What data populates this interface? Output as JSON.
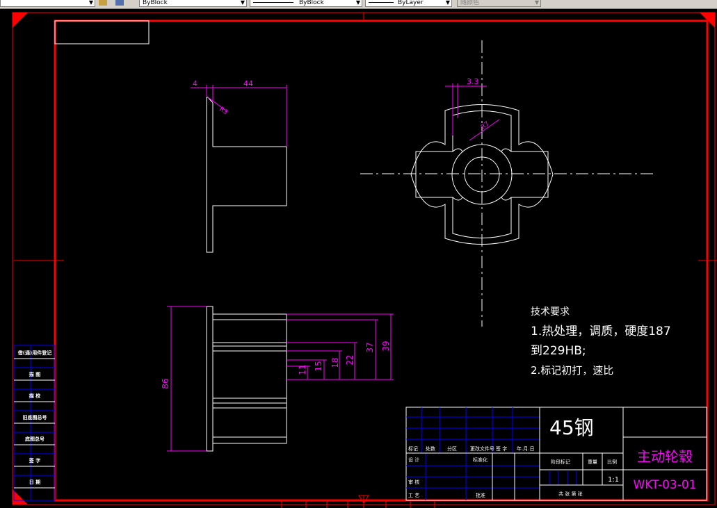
{
  "toolbar": {
    "linetype_value": "ByBlock",
    "lineweight_value": "ByBlock",
    "layer_lineweight_value": "ByLayer",
    "plotstyle_value": "随颜色"
  },
  "dims": {
    "d_4": "4",
    "d_44": "44",
    "r_r3": "R3",
    "d_3_3": "3.3",
    "r_r7": "R7",
    "d_86": "86",
    "d_11": "11",
    "d_15": "15",
    "d_18": "18",
    "d_22": "22",
    "d_37": "37",
    "d_39": "39"
  },
  "notes": {
    "heading": "技术要求",
    "line1": "1.热处理，调质，硬度187",
    "line2": "到229HB;",
    "line3": "2.标记初打，速比"
  },
  "side_labels": [
    "借(通)用件登记",
    "描  图",
    "描  校",
    "旧底图总号",
    "底图总号",
    "签  字",
    "日  期"
  ],
  "title_block": {
    "material": "45钢",
    "part_name": "主动轮毂",
    "drawing_number": "WKT-03-01",
    "scale": "1:1",
    "hdr_mark": "标记",
    "hdr_count": "处数",
    "hdr_zone": "分区",
    "hdr_change": "更改文件号",
    "hdr_sign": "签 字",
    "hdr_date": "年.月.日",
    "design": "设 计",
    "standardize": "标准化",
    "stage_mark": "阶段标记",
    "weight": "重量",
    "scale_label": "比例",
    "review": "审 核",
    "process": "工 艺",
    "approve": "批准",
    "sheets": "共   张  第   张"
  },
  "colors": {
    "frame": "#ff0000",
    "dimension": "#ff00ff",
    "geometry": "#ffffff",
    "titleblock_lines": "#0000ff"
  }
}
